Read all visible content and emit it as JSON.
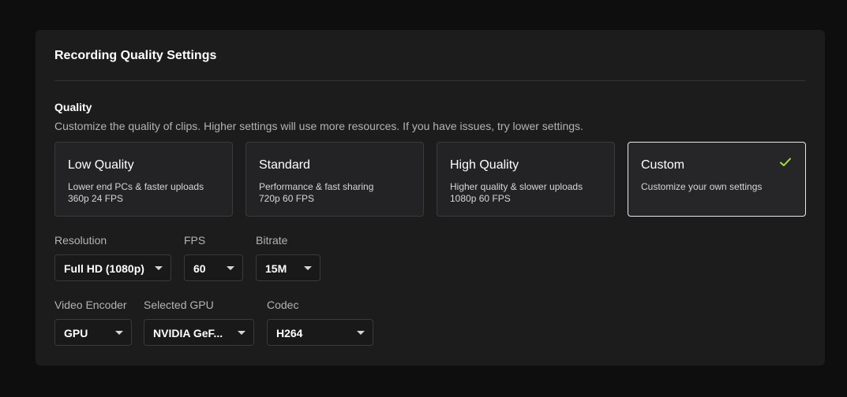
{
  "panel": {
    "title": "Recording Quality Settings"
  },
  "quality": {
    "title": "Quality",
    "description": "Customize the quality of clips. Higher settings will use more resources. If you have issues, try lower settings.",
    "presets": [
      {
        "title": "Low Quality",
        "line1": "Lower end PCs & faster uploads",
        "line2": "360p 24 FPS",
        "selected": false
      },
      {
        "title": "Standard",
        "line1": "Performance & fast sharing",
        "line2": "720p 60 FPS",
        "selected": false
      },
      {
        "title": "High Quality",
        "line1": "Higher quality & slower uploads",
        "line2": "1080p 60 FPS",
        "selected": false
      },
      {
        "title": "Custom",
        "line1": "Customize your own settings",
        "line2": "",
        "selected": true
      }
    ],
    "selected_icon": "check-icon",
    "accent_color": "#a3e635"
  },
  "fields": {
    "resolution": {
      "label": "Resolution",
      "value": "Full HD (1080p)"
    },
    "fps": {
      "label": "FPS",
      "value": "60"
    },
    "bitrate": {
      "label": "Bitrate",
      "value": "15M"
    },
    "video_encoder": {
      "label": "Video Encoder",
      "value": "GPU"
    },
    "selected_gpu": {
      "label": "Selected GPU",
      "value": "NVIDIA GeF..."
    },
    "codec": {
      "label": "Codec",
      "value": "H264"
    }
  },
  "icons": {
    "dropdown": "caret-down-icon"
  }
}
